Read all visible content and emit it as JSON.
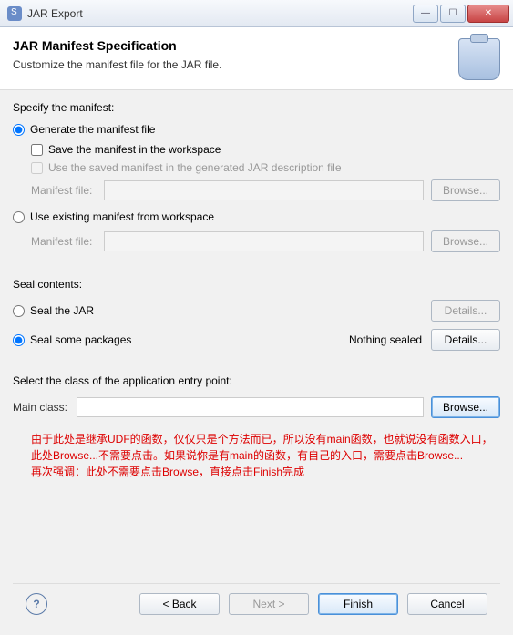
{
  "window": {
    "title": "JAR Export"
  },
  "header": {
    "title": "JAR Manifest Specification",
    "subtitle": "Customize the manifest file for the JAR file."
  },
  "manifest": {
    "section_label": "Specify the manifest:",
    "generate_label": "Generate the manifest file",
    "save_workspace_label": "Save the manifest in the workspace",
    "use_saved_label": "Use the saved manifest in the generated JAR description file",
    "manifest_file_label": "Manifest file:",
    "browse_label": "Browse...",
    "use_existing_label": "Use existing manifest from workspace",
    "manifest_value1": "",
    "manifest_value2": ""
  },
  "seal": {
    "section_label": "Seal contents:",
    "seal_jar_label": "Seal the JAR",
    "seal_some_label": "Seal some packages",
    "nothing_sealed": "Nothing sealed",
    "details_label": "Details..."
  },
  "main_class": {
    "section_label": "Select the class of the application entry point:",
    "label": "Main class:",
    "value": "",
    "browse_label": "Browse..."
  },
  "annotation": {
    "line1": "由于此处是继承UDF的函数，仅仅只是个方法而已，所以没有main函数，也就说没有函数入口，此处Browse...不需要点击。如果说你是有main的函数，有自己的入口，需要点击Browse...",
    "line2": "再次强调：此处不需要点击Browse，直接点击Finish完成"
  },
  "footer": {
    "back": "< Back",
    "next": "Next >",
    "finish": "Finish",
    "cancel": "Cancel"
  }
}
